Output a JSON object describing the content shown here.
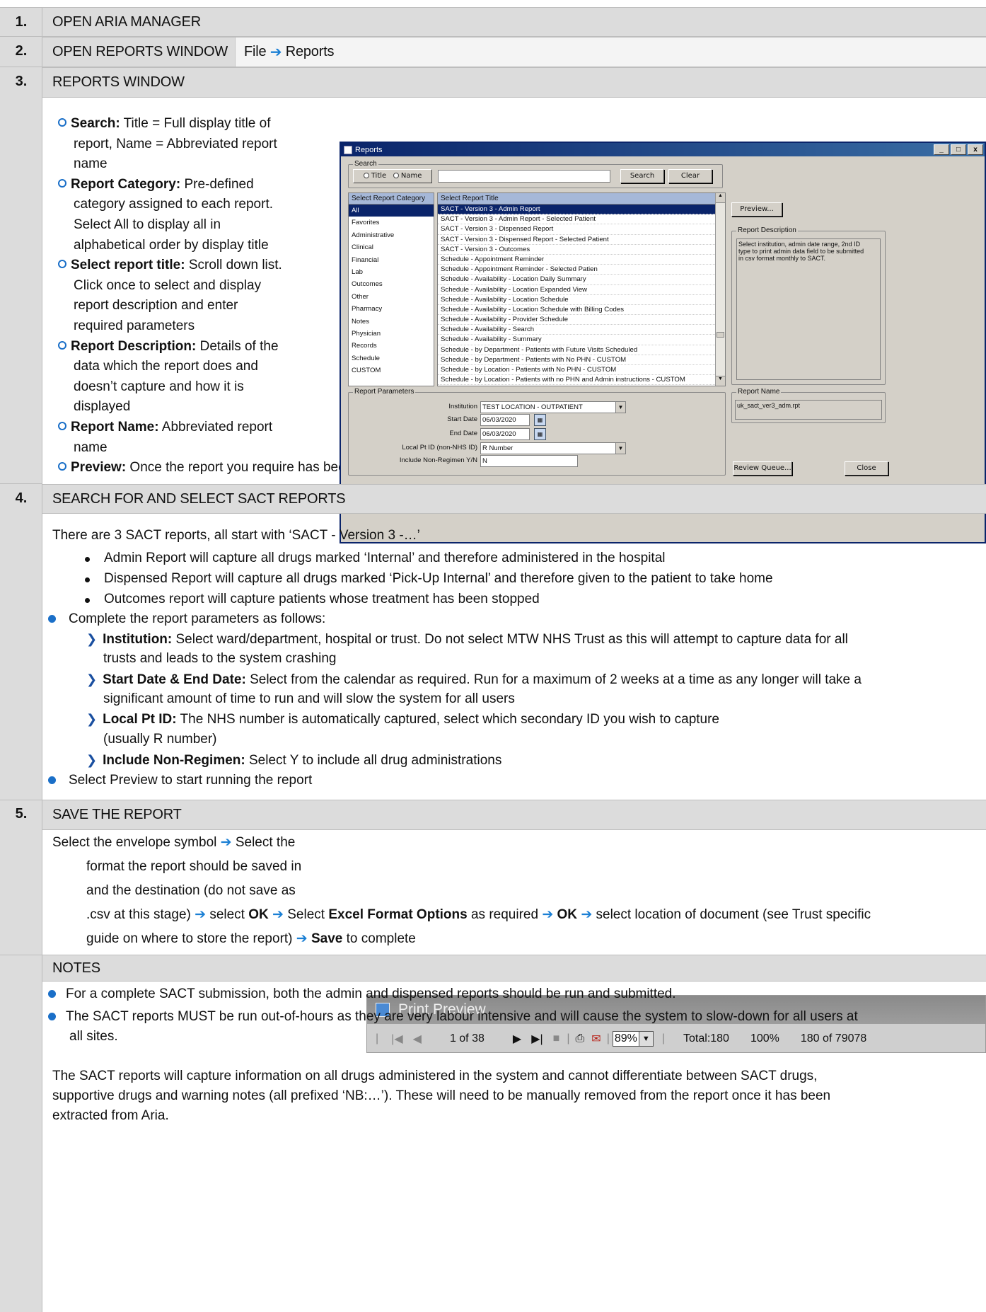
{
  "steps": [
    {
      "num": "1.",
      "title": "OPEN ARIA MANAGER"
    },
    {
      "num": "2.",
      "title": "OPEN REPORTS WINDOW",
      "action_a": "File",
      "action_b": "Reports"
    },
    {
      "num": "3.",
      "title": "REPORTS WINDOW"
    },
    {
      "num": "4.",
      "title": "SEARCH FOR AND SELECT SACT REPORTS"
    },
    {
      "num": "5.",
      "title": "SAVE THE REPORT"
    },
    {
      "num": "",
      "title": "NOTES"
    }
  ],
  "step3": {
    "items": [
      {
        "label": "Search:",
        "lines": [
          " Title = Full display title of",
          "report, Name = Abbreviated report",
          "name"
        ]
      },
      {
        "label": "Report Category:",
        "lines": [
          " Pre-defined",
          "category assigned to each report.",
          "Select All to display all in",
          "alphabetical order by display title"
        ]
      },
      {
        "label": "Select report title:",
        "lines": [
          " Scroll down list.",
          "Click once to select and display",
          "report description and enter",
          "required parameters"
        ]
      },
      {
        "label": "Report Description:",
        "lines": [
          " Details of the",
          "data which the report does and",
          "doesn’t capture and how it is",
          "displayed"
        ]
      },
      {
        "label": "Report Name:",
        "lines": [
          " Abbreviated report",
          "name"
        ]
      }
    ],
    "preview_label": "Preview:",
    "preview_text": " Once the report you require has been highlighted and any required parameters completed, select Preview to run the report."
  },
  "reports_window": {
    "title": "Reports",
    "search_group": "Search",
    "radio_title": "Title",
    "radio_name": "Name",
    "search_button": "Search",
    "clear_button": "Clear",
    "category_header": "Select Report Category",
    "categories": [
      "All",
      "Favorites",
      "Administrative",
      "Clinical",
      "Financial",
      "Lab",
      "Outcomes",
      "Other",
      "Pharmacy",
      "Notes",
      "Physician",
      "Records",
      "Schedule",
      "CUSTOM"
    ],
    "title_header": "Select Report Title",
    "titles": [
      "SACT - Version 3 - Admin Report",
      "SACT - Version 3 - Admin Report - Selected Patient",
      "SACT - Version 3 - Dispensed Report",
      "SACT - Version 3 - Dispensed Report - Selected Patient",
      "SACT - Version 3 - Outcomes",
      "Schedule - Appointment Reminder",
      "Schedule - Appointment Reminder - Selected Patien",
      "Schedule - Availability - Location Daily Summary",
      "Schedule - Availability - Location Expanded View",
      "Schedule - Availability - Location Schedule",
      "Schedule - Availability - Location Schedule with Billing Codes",
      "Schedule - Availability - Provider Schedule",
      "Schedule - Availability - Search",
      "Schedule - Availability - Summary",
      "Schedule - by Department - Patients with Future Visits Scheduled",
      "Schedule - by Department - Patients with No PHN - CUSTOM",
      "Schedule - by Location - Patients with No PHN - CUSTOM",
      "Schedule - by Location - Patients with no PHN and Admin instructions - CUSTOM"
    ],
    "preview_button": "Preview...",
    "desc_group": "Report Description",
    "desc_text": "Select institution, admin date range, 2nd ID type to print admin data field to be submitted in csv format monthly to SACT.",
    "params_group": "Report Parameters",
    "params": {
      "institution_label": "Institution",
      "institution_value": "TEST LOCATION - OUTPATIENT",
      "start_label": "Start Date",
      "start_value": "06/03/2020",
      "end_label": "End Date",
      "end_value": "06/03/2020",
      "localid_label": "Local Pt ID (non-NHS ID)",
      "localid_value": "R Number",
      "nonreg_label": "Include Non-Regimen Y/N",
      "nonreg_value": "N"
    },
    "name_group": "Report Name",
    "name_value": "uk_sact_ver3_adm.rpt",
    "review_button": "Review Queue...",
    "close_button": "Close"
  },
  "step4": {
    "intro": "There are 3 SACT reports, all start with ‘SACT - Version 3 -…’",
    "reports": [
      "Admin Report will capture all drugs marked ‘Internal’ and therefore administered in the hospital",
      "Dispensed Report will capture all drugs marked ‘Pick-Up Internal’ and therefore given to the patient to take home",
      "Outcomes report will capture patients whose treatment has been stopped"
    ],
    "complete": "Complete the report parameters as follows:",
    "params": [
      {
        "label": "Institution:",
        "lines": [
          " Select ward/department, hospital or trust. Do not select MTW NHS Trust as this will attempt to capture data for all",
          "trusts and leads to the system crashing"
        ]
      },
      {
        "label": "Start Date & End Date:",
        "lines": [
          " Select from the calendar as required. Run for a maximum of 2 weeks at a time as any longer will take a",
          "significant amount of time to run and will slow the system for all users"
        ]
      },
      {
        "label": "Local Pt ID:",
        "lines": [
          " The NHS number is automatically captured, select which secondary ID you wish to capture",
          "(usually R number)"
        ]
      },
      {
        "label": "Include Non-Regimen:",
        "lines": [
          " Select Y to include all drug administrations"
        ]
      }
    ],
    "final": "Select Preview to start running the report"
  },
  "step5": {
    "l1": "Select the envelope symbol ",
    "l1b": " Select the",
    "l2": "format the report should be saved in",
    "l3": "and the destination (do not save as",
    "l4a": ".csv at this stage) ",
    "l4b": " select ",
    "ok": "OK",
    "l4c": " Select ",
    "excel": "Excel Format Options",
    "l4d": " as required ",
    "l4e": " select location of document (see Trust specific",
    "l5a": "guide on where to store the report) ",
    "save": "Save",
    "l5b": " to complete"
  },
  "print_preview": {
    "title": "Print Preview",
    "page": "1 of 38",
    "zoom": "89%",
    "total": "Total:180",
    "pct": "100%",
    "count": "180 of 79078"
  },
  "notes": {
    "b1": "For a complete SACT submission, both the admin and dispensed reports should be run and submitted.",
    "b2a": "The SACT reports MUST be run out-of-hours as they are very labour intensive and will cause the system to slow-down for all users at",
    "b2b": "all sites.",
    "p1": "The SACT reports will capture information on all drugs administered in the system and cannot differentiate between SACT drugs,",
    "p2": "supportive drugs and warning notes (all prefixed ‘NB:…’). These will need to be manually removed from the report once it has been",
    "p3": "extracted from Aria."
  },
  "colors": {
    "header_bg": "#dcdcdc",
    "arrow": "#1a7fd4",
    "bullet": "#1a6fc8",
    "selection": "#0a246a"
  }
}
